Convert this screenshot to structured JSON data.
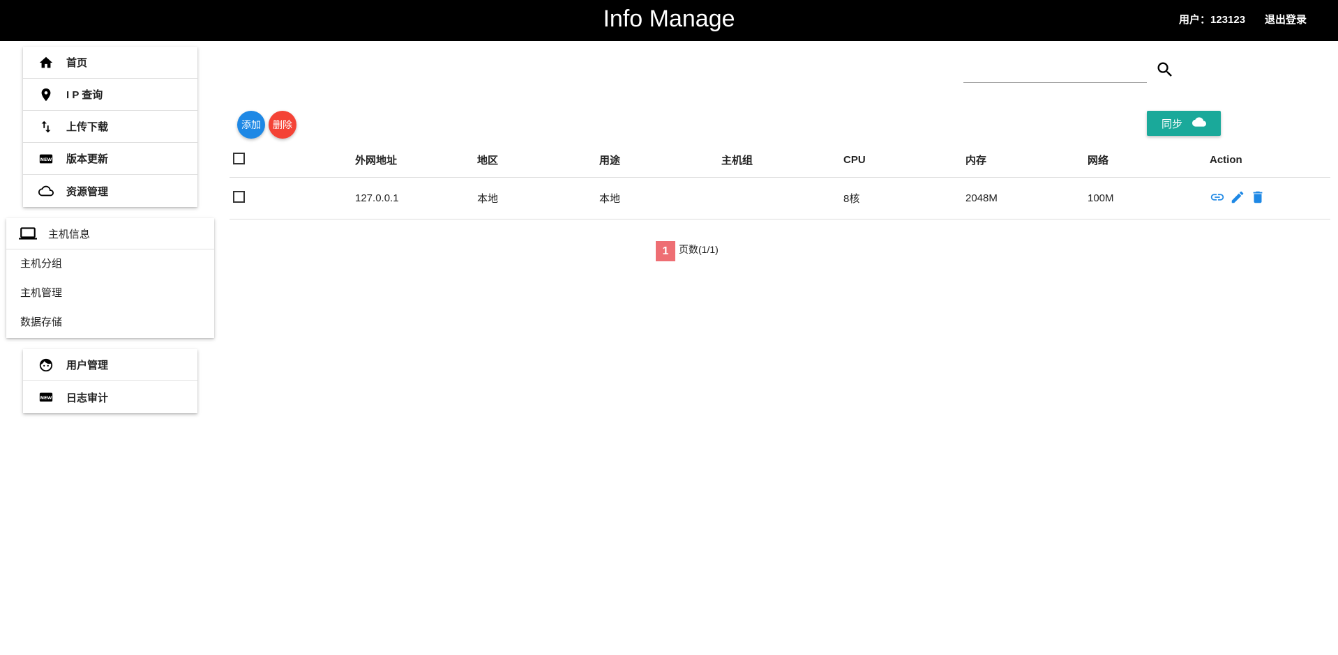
{
  "header": {
    "title": "Info Manage",
    "user": "用户：123123",
    "logout": "退出登录"
  },
  "sidebar": {
    "top_items": [
      {
        "label": "首页",
        "icon": "home-icon"
      },
      {
        "label": "I P 查询",
        "icon": "location-pin-icon"
      },
      {
        "label": "上传下载",
        "icon": "swap-vert-icon"
      },
      {
        "label": "版本更新",
        "icon": "new-badge-icon"
      },
      {
        "label": "资源管理",
        "icon": "cloud-icon"
      }
    ],
    "host_group": {
      "label": "主机信息",
      "icon": "laptop-icon",
      "sub_items": [
        "主机分组",
        "主机管理",
        "数据存储"
      ]
    },
    "bottom_items": [
      {
        "label": "用户管理",
        "icon": "face-icon"
      },
      {
        "label": "日志审计",
        "icon": "new-badge-icon"
      }
    ]
  },
  "search": {
    "value": "",
    "placeholder": ""
  },
  "toolbar": {
    "add_label": "添加",
    "delete_label": "删除",
    "sync_label": "同步"
  },
  "table": {
    "columns": [
      "外网地址",
      "地区",
      "用途",
      "主机组",
      "CPU",
      "内存",
      "网络",
      "Action"
    ],
    "rows": [
      {
        "ip": "127.0.0.1",
        "region": "本地",
        "usage": "本地",
        "group": "",
        "cpu": "8核",
        "memory": "2048M",
        "network": "100M"
      }
    ]
  },
  "pagination": {
    "current": "1",
    "info": "页数(1/1)"
  },
  "colors": {
    "header_bg": "#000000",
    "add": "#1e88e5",
    "delete": "#f44336",
    "sync": "#1aa99a",
    "page_active": "#ee6e73",
    "action_icon": "#1e88e5"
  }
}
